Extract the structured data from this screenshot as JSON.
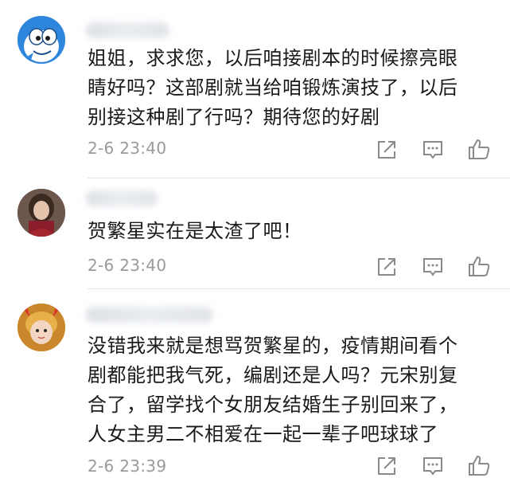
{
  "comments": [
    {
      "text": "姐姐，求求您，以后咱接剧本的时候擦亮眼\n睛好吗？这部剧就当给咱锻炼演技了，以后\n别接这种剧了行吗？期待您的好剧",
      "time": "2-6 23:40",
      "avatar_icon": "cartoon-fish-avatar"
    },
    {
      "text": "贺繁星实在是太渣了吧！",
      "time": "2-6 23:40",
      "avatar_icon": "user-photo-avatar"
    },
    {
      "text": "没错我来就是想骂贺繁星的，疫情期间看个\n剧都能把我气死，编剧还是人吗？元宋别复\n合了，留学找个女朋友结婚生子别回来了，\n人女主男二不相爱在一起一辈子吧球球了",
      "time": "2-6 23:39",
      "avatar_icon": "child-photo-avatar"
    }
  ],
  "colors": {
    "text": "#1a1a1a",
    "meta": "#9a9a9a",
    "icon": "#8a8a8a",
    "divider": "#e6e6e6"
  }
}
